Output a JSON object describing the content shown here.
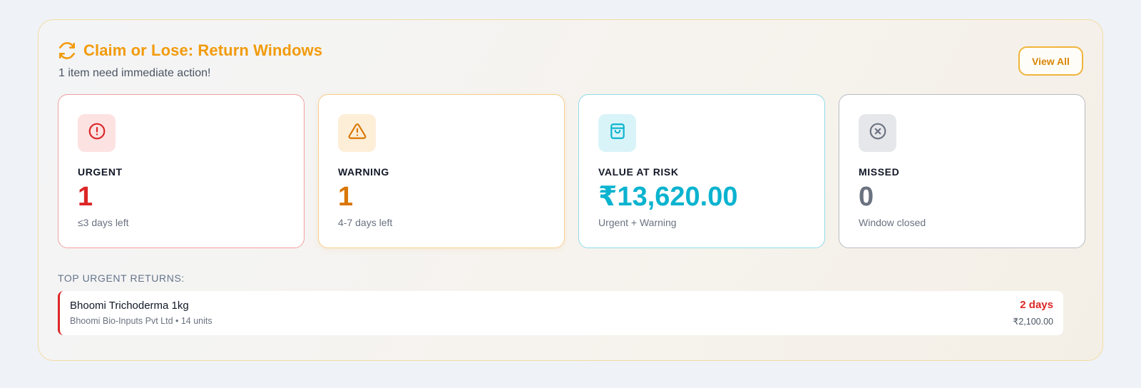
{
  "header": {
    "title": "Claim or Lose: Return Windows",
    "subtitle": "1 item need immediate action!",
    "view_all_label": "View All",
    "icon": "refresh-icon"
  },
  "colors": {
    "accent": "#f29b0c",
    "urgent": "#dc2626",
    "warning": "#d97706",
    "value": "#0bb3cf",
    "missed": "#6b7280"
  },
  "cards": [
    {
      "label": "URGENT",
      "value": "1",
      "sub": "≤3 days left",
      "icon": "alert-circle-icon"
    },
    {
      "label": "WARNING",
      "value": "1",
      "sub": "4-7 days left",
      "icon": "alert-triangle-icon"
    },
    {
      "label": "VALUE AT RISK",
      "value": "₹13,620.00",
      "sub": "Urgent + Warning",
      "icon": "shopping-bag-icon"
    },
    {
      "label": "MISSED",
      "value": "0",
      "sub": "Window closed",
      "icon": "x-circle-icon"
    }
  ],
  "urgent_returns": {
    "section_label": "TOP URGENT RETURNS:",
    "items": [
      {
        "name": "Bhoomi Trichoderma 1kg",
        "meta": "Bhoomi Bio-Inputs Pvt Ltd • 14 units",
        "days": "2 days",
        "amount": "₹2,100.00"
      }
    ]
  }
}
